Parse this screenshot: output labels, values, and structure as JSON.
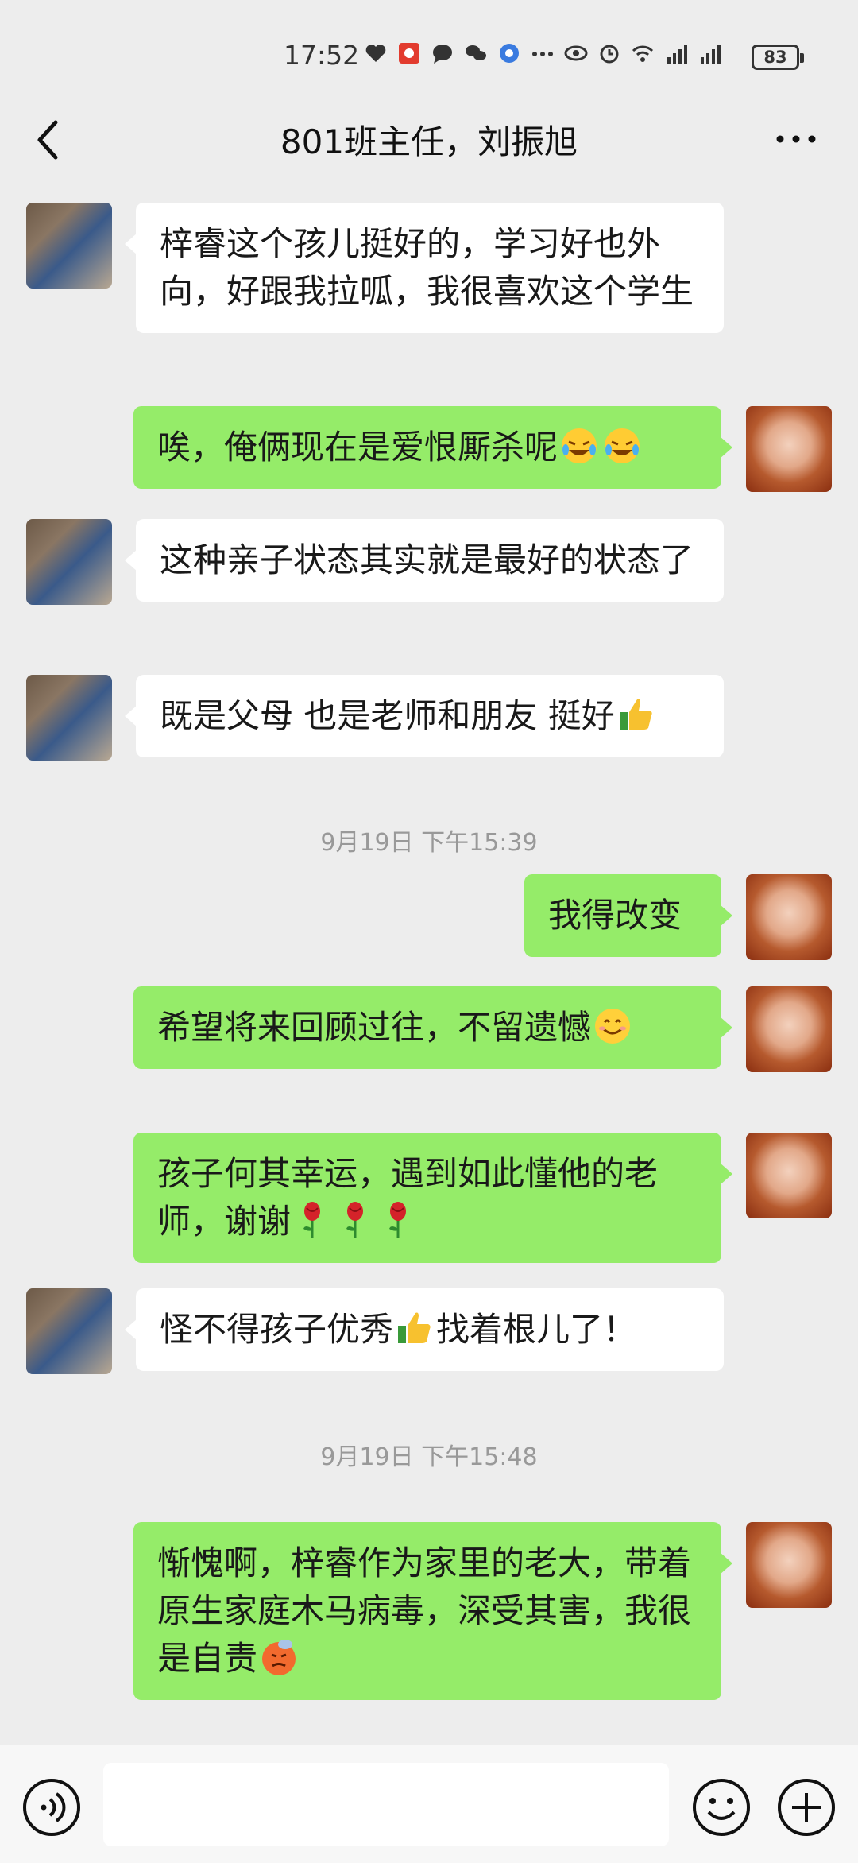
{
  "status_bar": {
    "time": "17:52",
    "battery": "83"
  },
  "header": {
    "title": "801班主任，刘振旭"
  },
  "messages": [
    {
      "text": "梓睿这个孩儿挺好的，学习好也外向，好跟我拉呱，我很喜欢这个学生"
    },
    {
      "text": "唉，俺俩现在是爱恨厮杀呢",
      "emoji": "laughing-crying-emoji"
    },
    {
      "text": "这种亲子状态其实就是最好的状态了"
    },
    {
      "text": "既是父母 也是老师和朋友 挺好",
      "emoji": "thumbs-up-emoji"
    },
    {
      "text": "我得改变"
    },
    {
      "text": "希望将来回顾过往，不留遗憾",
      "emoji": "smile-emoji"
    },
    {
      "text": "孩子何其幸运，遇到如此懂他的老师，谢谢",
      "emoji": "rose-emoji"
    },
    {
      "text_before": "怪不得孩子优秀",
      "text_after": "找着根儿了！",
      "emoji": "thumbs-up-emoji"
    },
    {
      "text": "惭愧啊，梓睿作为家里的老大，带着原生家庭木马病毒，深受其害，我很是自责",
      "emoji": "awkward-emoji"
    }
  ],
  "timestamps": [
    "9月19日 下午15:39",
    "9月19日 下午15:48"
  ],
  "input": {
    "placeholder": ""
  }
}
